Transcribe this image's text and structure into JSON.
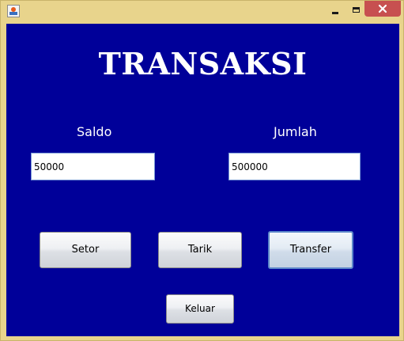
{
  "window": {
    "controls": [
      "minimize-icon",
      "maximize-icon",
      "close-icon"
    ]
  },
  "form": {
    "title": "TRANSAKSI",
    "saldo_label": "Saldo",
    "saldo_value": "50000",
    "jumlah_label": "Jumlah",
    "jumlah_value": "500000"
  },
  "buttons": {
    "setor": "Setor",
    "tarik": "Tarik",
    "transfer": "Transfer",
    "keluar": "Keluar"
  },
  "colors": {
    "panel_background": "#000099",
    "window_frame": "#e8d48c",
    "close_button": "#c75050",
    "text": "#ffffff"
  }
}
